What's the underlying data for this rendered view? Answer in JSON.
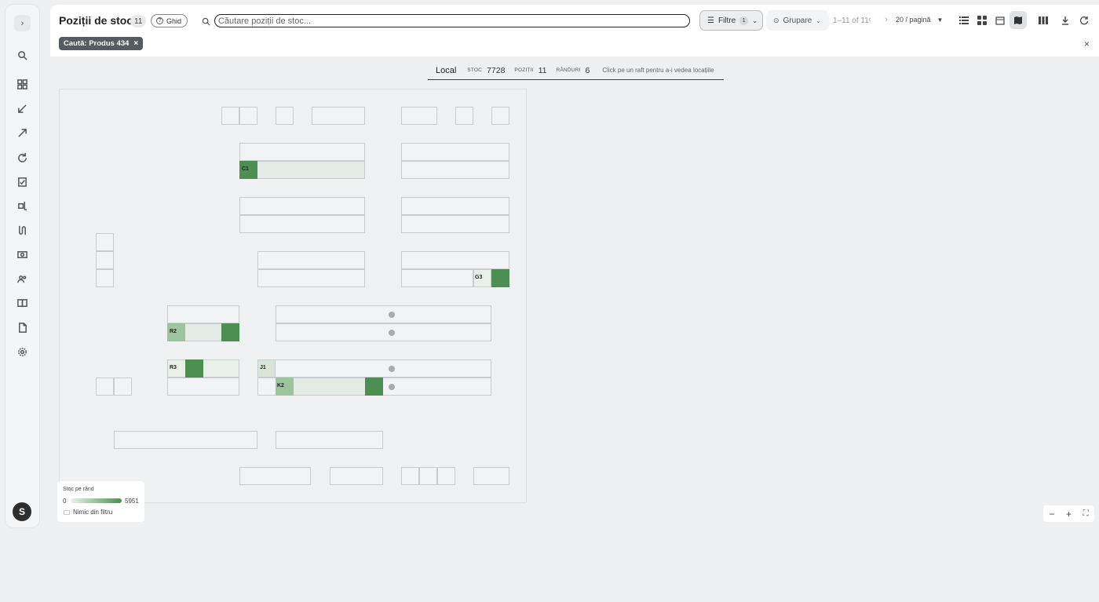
{
  "header": {
    "title": "Poziții de stoc",
    "count": "11",
    "guide_label": "Ghid",
    "search_placeholder": "Căutare poziții de stoc...",
    "filter_label": "Filtre",
    "filter_count": "1",
    "group_label": "Grupare",
    "pager_range": "1–11 of 11",
    "per_page": "20 / pagină",
    "active_view": "map"
  },
  "filter_chip": {
    "label": "Caută: Produs 434"
  },
  "info": {
    "location": "Local",
    "stock_label": "STOC",
    "stock_value": "7728",
    "positions_label": "POZIȚII",
    "positions_value": "11",
    "rows_label": "RÂNDURI",
    "rows_value": "6",
    "hint": "Click pe un raft pentru a-i vedea locațiile"
  },
  "map": {
    "shelves": [
      "C1",
      "G3",
      "R2",
      "R3",
      "J1",
      "K2"
    ]
  },
  "legend": {
    "title": "Stoc pe rând",
    "min": "0",
    "max": "5951",
    "empty_label": "Nimic din filtru"
  },
  "user": {
    "initial": "S"
  },
  "colors": {
    "stock_high": "#4d8f53",
    "stock_mid": "#9cc49f",
    "stock_low": "#dfe9df"
  }
}
